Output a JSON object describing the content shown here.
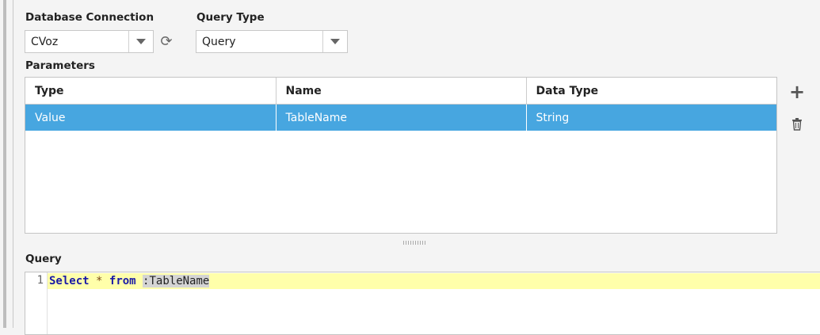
{
  "connection": {
    "label": "Database Connection",
    "value": "CVoz"
  },
  "query_type": {
    "label": "Query Type",
    "value": "Query"
  },
  "parameters": {
    "label": "Parameters",
    "columns": [
      "Type",
      "Name",
      "Data Type"
    ],
    "rows": [
      {
        "type": "Value",
        "name": "TableName",
        "data_type": "String"
      }
    ]
  },
  "query": {
    "label": "Query",
    "line_number": "1",
    "kw_select": "Select",
    "star": "*",
    "kw_from": "from",
    "param": ":TableName"
  },
  "icons": [
    "refresh-icon",
    "add-icon",
    "trash-icon",
    "splitter-handle-icon"
  ]
}
